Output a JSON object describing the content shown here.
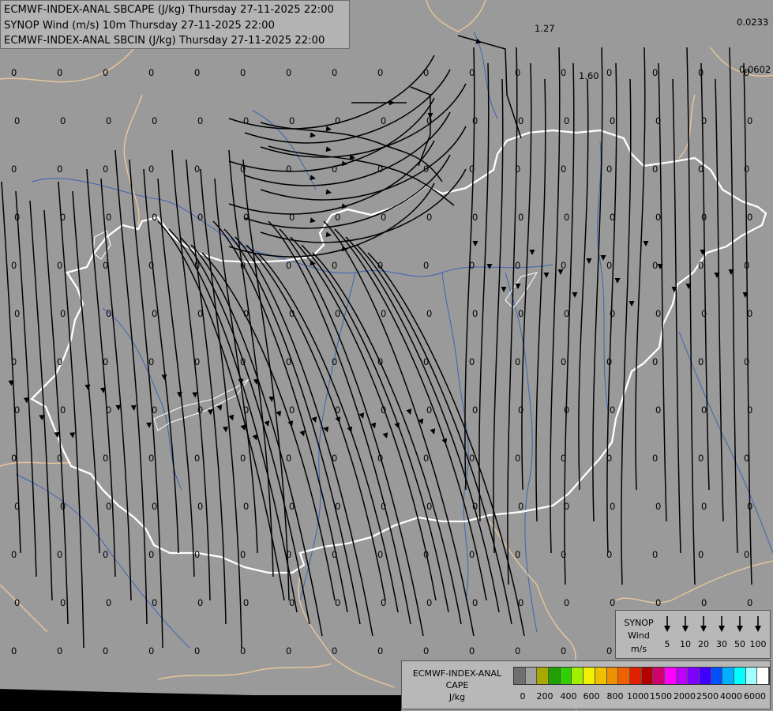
{
  "header": {
    "line1": "ECMWF-INDEX-ANAL SBCAPE (J/kg) Thursday 27-11-2025 22:00",
    "line2": "SYNOP Wind (m/s) 10m Thursday 27-11-2025 22:00",
    "line3": "ECMWF-INDEX-ANAL SBCIN (J/kg) Thursday 27-11-2025 22:00"
  },
  "map_values": {
    "zero_label": "0",
    "special": [
      "1.27",
      "1.60",
      "0.0233",
      "0.0602"
    ]
  },
  "wind_legend": {
    "title_line1": "SYNOP",
    "title_line2": "Wind",
    "unit": "m/s",
    "speeds": [
      "5",
      "10",
      "20",
      "30",
      "50",
      "100"
    ]
  },
  "cape_legend": {
    "title_line1": "ECMWF-INDEX-ANAL",
    "title_line2": "CAPE",
    "unit": "J/kg",
    "ticks": [
      "0",
      "200",
      "400",
      "600",
      "800",
      "1000",
      "1500",
      "2000",
      "2500",
      "4000",
      "6000"
    ],
    "colors": [
      "#6f6f6f",
      "#a0a0a0",
      "#a8a800",
      "#20a000",
      "#30d000",
      "#a0f000",
      "#f0f000",
      "#f0c000",
      "#f09000",
      "#f06000",
      "#e02000",
      "#b00000",
      "#d00070",
      "#ff00ff",
      "#c000ff",
      "#8000ff",
      "#4000ff",
      "#0050ff",
      "#00b0ff",
      "#00ffff",
      "#a0ffff",
      "#ffffff"
    ]
  },
  "colors": {
    "background": "#9a9a9a",
    "country_border": "#ffffff",
    "neighbor_border": "#e8c79a",
    "rivers": "#3b64b4",
    "streamlines": "#000000"
  }
}
